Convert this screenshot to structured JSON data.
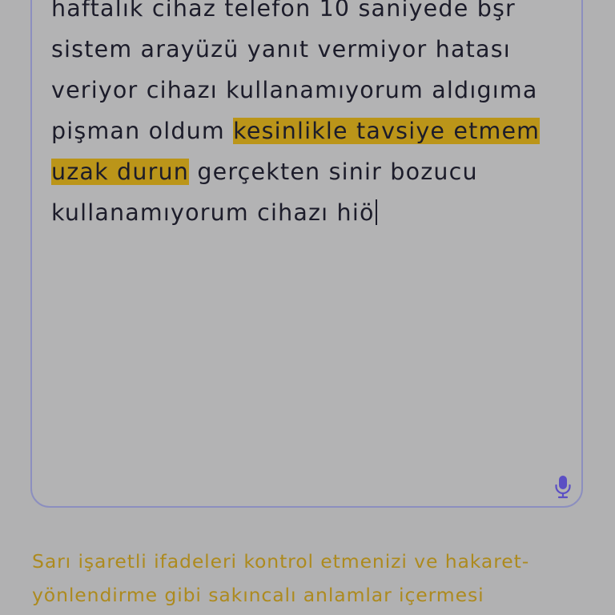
{
  "review_input": {
    "lines": [
      {
        "text": "haftalık cihaz telefon 10 saniyede bşr"
      },
      {
        "text": "sistem arayüzü yanıt vermiyor hatası"
      },
      {
        "text": "veriyor cihazı kullanamıyorum aldıgıma"
      },
      {
        "before": "pişman oldum ",
        "highlight": "kesinlikle tavsiye etmem"
      },
      {
        "highlight": "uzak durun",
        "after": " gerçekten sinir bozucu"
      },
      {
        "text": "kullanamıyorum cihazı hiö"
      }
    ]
  },
  "icons": {
    "mic": "microphone-icon"
  },
  "warning": {
    "lines": [
      "Sarı işaretli ifadeleri kontrol etmenizi ve hakaret-",
      "yönlendirme gibi sakıncalı anlamlar içermesi"
    ]
  },
  "colors": {
    "background": "#b1b1b2",
    "text": "#1c1c2a",
    "highlight": "#bb9519",
    "warning_text": "#ad8a1e",
    "accent": "#5b4fc4",
    "input_border": "#8c8fbf"
  }
}
